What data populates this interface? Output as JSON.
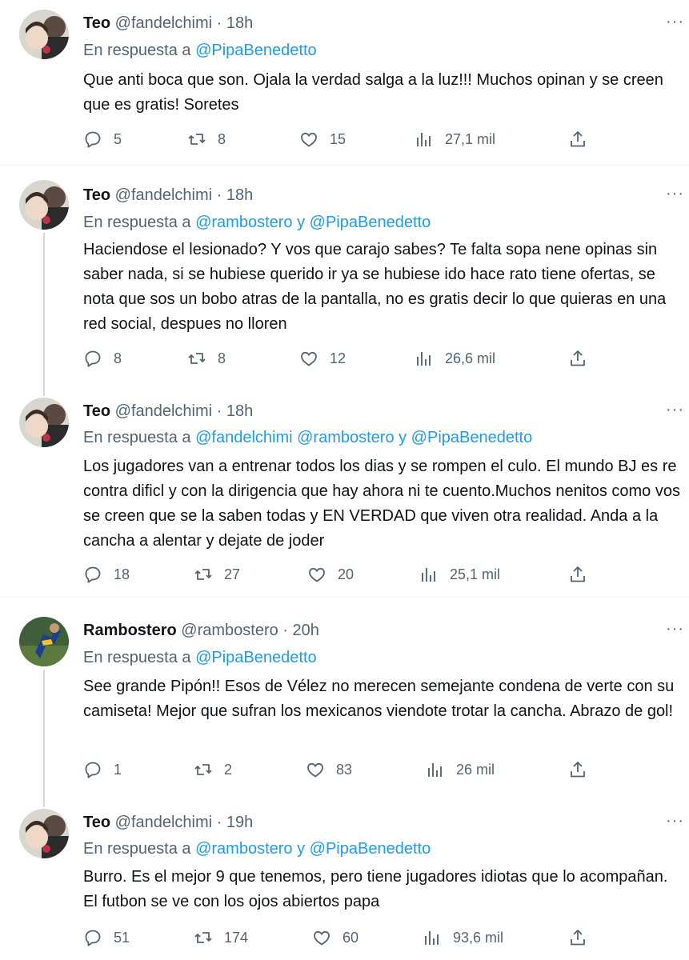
{
  "tweets": [
    {
      "name": "Teo",
      "handle": "@fandelchimi",
      "time": "18h",
      "reply_prefix": "En respuesta a ",
      "mentions": "@PipaBenedetto",
      "text": "Que anti boca que son. Ojala la verdad salga a la luz!!! Muchos opinan y se creen que es gratis! Soretes",
      "replies": "5",
      "retweets": "8",
      "likes": "15",
      "views": "27,1 mil"
    },
    {
      "name": "Teo",
      "handle": "@fandelchimi",
      "time": "18h",
      "reply_prefix": "En respuesta a ",
      "mentions": "@rambostero y @PipaBenedetto",
      "text": "Haciendose el lesionado? Y vos que carajo sabes? Te falta sopa nene opinas sin saber nada, si se hubiese querido ir ya se hubiese ido hace rato tiene ofertas, se nota que sos un bobo atras de la pantalla, no es gratis decir lo que quieras en una red social, despues no lloren",
      "replies": "8",
      "retweets": "8",
      "likes": "12",
      "views": "26,6 mil"
    },
    {
      "name": "Teo",
      "handle": "@fandelchimi",
      "time": "18h",
      "reply_prefix": "En respuesta a ",
      "mentions": "@fandelchimi @rambostero y @PipaBenedetto",
      "text": "Los jugadores van a entrenar todos los dias y se rompen el culo. El mundo BJ es re contra dificl y con la dirigencia que hay ahora ni te cuento.Muchos nenitos como vos se creen que se la saben todas y EN VERDAD que viven otra realidad. Anda a la cancha a alentar y dejate de joder",
      "replies": "18",
      "retweets": "27",
      "likes": "20",
      "views": "25,1 mil"
    },
    {
      "name": "Rambostero",
      "handle": "@rambostero",
      "time": "20h",
      "reply_prefix": "En respuesta a ",
      "mentions": "@PipaBenedetto",
      "text": "See grande Pipón!! Esos de Vélez no merecen semejante condena de verte con su camiseta! Mejor que sufran los mexicanos viendote trotar la cancha. Abrazo de gol!",
      "replies": "1",
      "retweets": "2",
      "likes": "83",
      "views": "26 mil"
    },
    {
      "name": "Teo",
      "handle": "@fandelchimi",
      "time": "19h",
      "reply_prefix": "En respuesta a ",
      "mentions": "@rambostero y @PipaBenedetto",
      "text": "Burro. Es el mejor 9 que tenemos, pero tiene jugadores idiotas que lo acompañan. El futbon se ve con los ojos abiertos papa",
      "replies": "51",
      "retweets": "174",
      "likes": "60",
      "views": "93,6 mil"
    }
  ],
  "separator": " · ",
  "more_glyph": "···",
  "colors": {
    "mention": "#1d9bf0",
    "secondary": "#536471",
    "divider": "#eff3f4",
    "thread": "#cfd9de"
  },
  "icons": [
    "reply-icon",
    "retweet-icon",
    "like-icon",
    "views-icon",
    "share-icon",
    "more-icon"
  ]
}
